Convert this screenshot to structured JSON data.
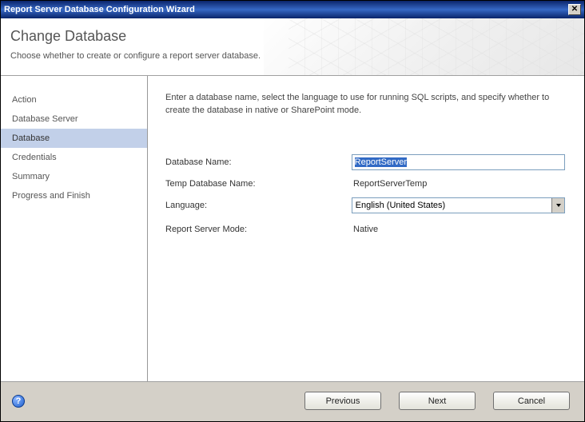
{
  "window": {
    "title": "Report Server Database Configuration Wizard"
  },
  "header": {
    "title": "Change Database",
    "subtitle": "Choose whether to create or configure a report server database."
  },
  "sidebar": {
    "items": [
      {
        "label": "Action",
        "active": false
      },
      {
        "label": "Database Server",
        "active": false
      },
      {
        "label": "Database",
        "active": true
      },
      {
        "label": "Credentials",
        "active": false
      },
      {
        "label": "Summary",
        "active": false
      },
      {
        "label": "Progress and Finish",
        "active": false
      }
    ]
  },
  "main": {
    "instruction": "Enter a database name, select the language to use for running SQL scripts, and specify whether to create the database in native or SharePoint mode.",
    "fields": {
      "db_name_label": "Database Name:",
      "db_name_value": "ReportServer",
      "temp_db_label": "Temp Database Name:",
      "temp_db_value": "ReportServerTemp",
      "lang_label": "Language:",
      "lang_value": "English (United States)",
      "mode_label": "Report Server Mode:",
      "mode_value": "Native"
    }
  },
  "footer": {
    "previous": "Previous",
    "next": "Next",
    "cancel": "Cancel"
  }
}
